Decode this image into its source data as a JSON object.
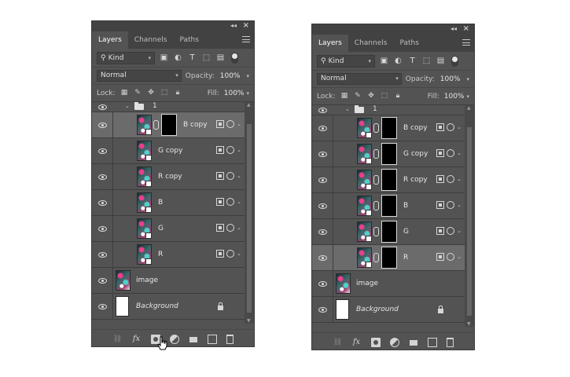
{
  "left_panel": {
    "tabs": [
      {
        "label": "Layers",
        "active": true
      },
      {
        "label": "Channels",
        "active": false
      },
      {
        "label": "Paths",
        "active": false
      }
    ],
    "filter": {
      "kind_label": "Kind"
    },
    "blend": {
      "mode": "Normal",
      "opacity_label": "Opacity:",
      "opacity_value": "100%"
    },
    "lock": {
      "label": "Lock:",
      "fill_label": "Fill:",
      "fill_value": "100%"
    },
    "group_name": "1",
    "layers": [
      {
        "name": "B copy",
        "has_mask": true,
        "selected": true
      },
      {
        "name": "G copy",
        "has_mask": false,
        "selected": false
      },
      {
        "name": "R copy",
        "has_mask": false,
        "selected": false
      },
      {
        "name": "B",
        "has_mask": false,
        "selected": false
      },
      {
        "name": "G",
        "has_mask": false,
        "selected": false
      },
      {
        "name": "R",
        "has_mask": false,
        "selected": false
      }
    ],
    "image_layer": "image",
    "background_layer": "Background",
    "footer": {
      "fx_label": "fx"
    }
  },
  "right_panel": {
    "tabs": [
      {
        "label": "Layers",
        "active": true
      },
      {
        "label": "Channels",
        "active": false
      },
      {
        "label": "Paths",
        "active": false
      }
    ],
    "filter": {
      "kind_label": "Kind"
    },
    "blend": {
      "mode": "Normal",
      "opacity_label": "Opacity:",
      "opacity_value": "100%"
    },
    "lock": {
      "label": "Lock:",
      "fill_label": "Fill:",
      "fill_value": "100%"
    },
    "group_name": "1",
    "layers": [
      {
        "name": "B copy",
        "has_mask": true,
        "selected": false
      },
      {
        "name": "G copy",
        "has_mask": true,
        "selected": false
      },
      {
        "name": "R copy",
        "has_mask": true,
        "selected": false
      },
      {
        "name": "B",
        "has_mask": true,
        "selected": false
      },
      {
        "name": "G",
        "has_mask": true,
        "selected": false
      },
      {
        "name": "R",
        "has_mask": true,
        "selected": true
      }
    ],
    "image_layer": "image",
    "background_layer": "Background",
    "footer": {
      "fx_label": "fx"
    }
  },
  "icons": {
    "collapse": "double-chevron-left-icon",
    "close": "close-icon",
    "panel_menu": "hamburger-menu-icon",
    "filter_pixel": "image-filter-icon",
    "filter_adjustment": "adjustment-filter-icon",
    "filter_type": "type-filter-icon",
    "filter_shape": "shape-filter-icon",
    "filter_smart": "smart-object-filter-icon",
    "visibility": "eye-icon",
    "link_mask": "chain-link-icon"
  },
  "colors": {
    "panel_bg": "#535353",
    "tab_bar_bg": "#424242",
    "selected_row": "#6b6b6b",
    "text": "#e6e6e6"
  }
}
